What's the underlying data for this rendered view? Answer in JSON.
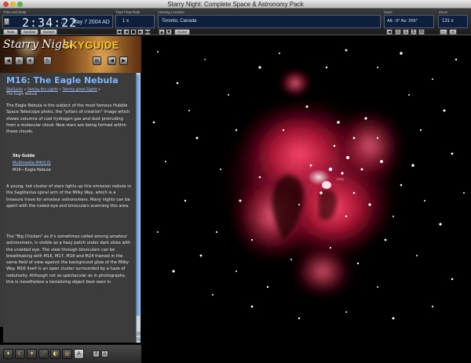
{
  "window": {
    "title": "Starry Night: Complete Space & Astronomy Pack"
  },
  "time_panel": {
    "label": "Time and Date",
    "time": "2:34:22",
    "ampm_top": "AM",
    "ampm_bottom": "PM",
    "date": "May   7 2004 AD",
    "now_label": "Now",
    "sunrise_label": "Sunrise",
    "sunset_label": "Sunset"
  },
  "time_flow": {
    "label": "Time Flow Rate",
    "value": "1 x"
  },
  "location": {
    "label": "Viewing Location",
    "value": "Toronto, Canada",
    "home_label": "Home"
  },
  "gaze": {
    "label": "Gaze",
    "value": "Alt: -9° Az: 269°",
    "compass": [
      "N",
      "S",
      "E",
      "W"
    ]
  },
  "zoom": {
    "label": "Zoom",
    "value": "131 x"
  },
  "sidebar": {
    "brand_main": "Starry Night",
    "brand_sub": "SKYGUIDE",
    "page_title": "M16: The Eagle Nebula",
    "breadcrumb": {
      "items": [
        "SkyGuide",
        "Seeing the sights",
        "Twenty great Sights"
      ],
      "current": "The Eagle Nebula",
      "separator": " » "
    },
    "paragraphs": [
      "The Eagle Nebula is the subject of the most famous Hubble Space Telescope photo, the \"pillars of creation\" image which shows columns of cool hydrogen gas and dust protruding from a molecular cloud. New stars are being formed within these clouds.",
      "A young, hot cluster of stars lights up this emission nebula in the Sagittarius spiral arm of the Milky Way, which is a treasure trove for amateur astronomers. Many nights can be spent with the naked eye and binoculars scanning this area.",
      "The \"Big Chicken\" as it's sometimes called among amateur astronomers, is visible as a hazy patch under dark skies with the unaided eye. The view through binoculars can be breathtaking with M16, M17, M18 and M24 framed in the same field of view against the background glow of the Milky Way. M16 itself is an open cluster surrounded by a haze of nebulosity. Although not as spectacular as in photographs, this is nonetheless a tantalizing object best seen in"
    ],
    "sky_guide_block": {
      "title": "Sky Guide",
      "lines": [
        "Multimedia M4(9.0)",
        "M16—Eagle Nebula"
      ]
    },
    "text_size_small": "A",
    "text_size_large": "A"
  },
  "sky_view": {
    "object_label": "M16"
  },
  "colors": {
    "nebula": "#e0204a",
    "heading": "#7fb6ff",
    "panel": "#0d1f3a",
    "brand_accent": "#f7c62c"
  },
  "icons": {
    "back": "arrow-left-icon",
    "home": "home-icon",
    "bookmark": "bookmark-icon",
    "reload": "reload-icon",
    "print": "print-icon",
    "tools": [
      "telescope-icon",
      "moon-icon",
      "star-icon",
      "constellation-icon",
      "planet-icon",
      "globe-icon",
      "text-icon"
    ]
  }
}
